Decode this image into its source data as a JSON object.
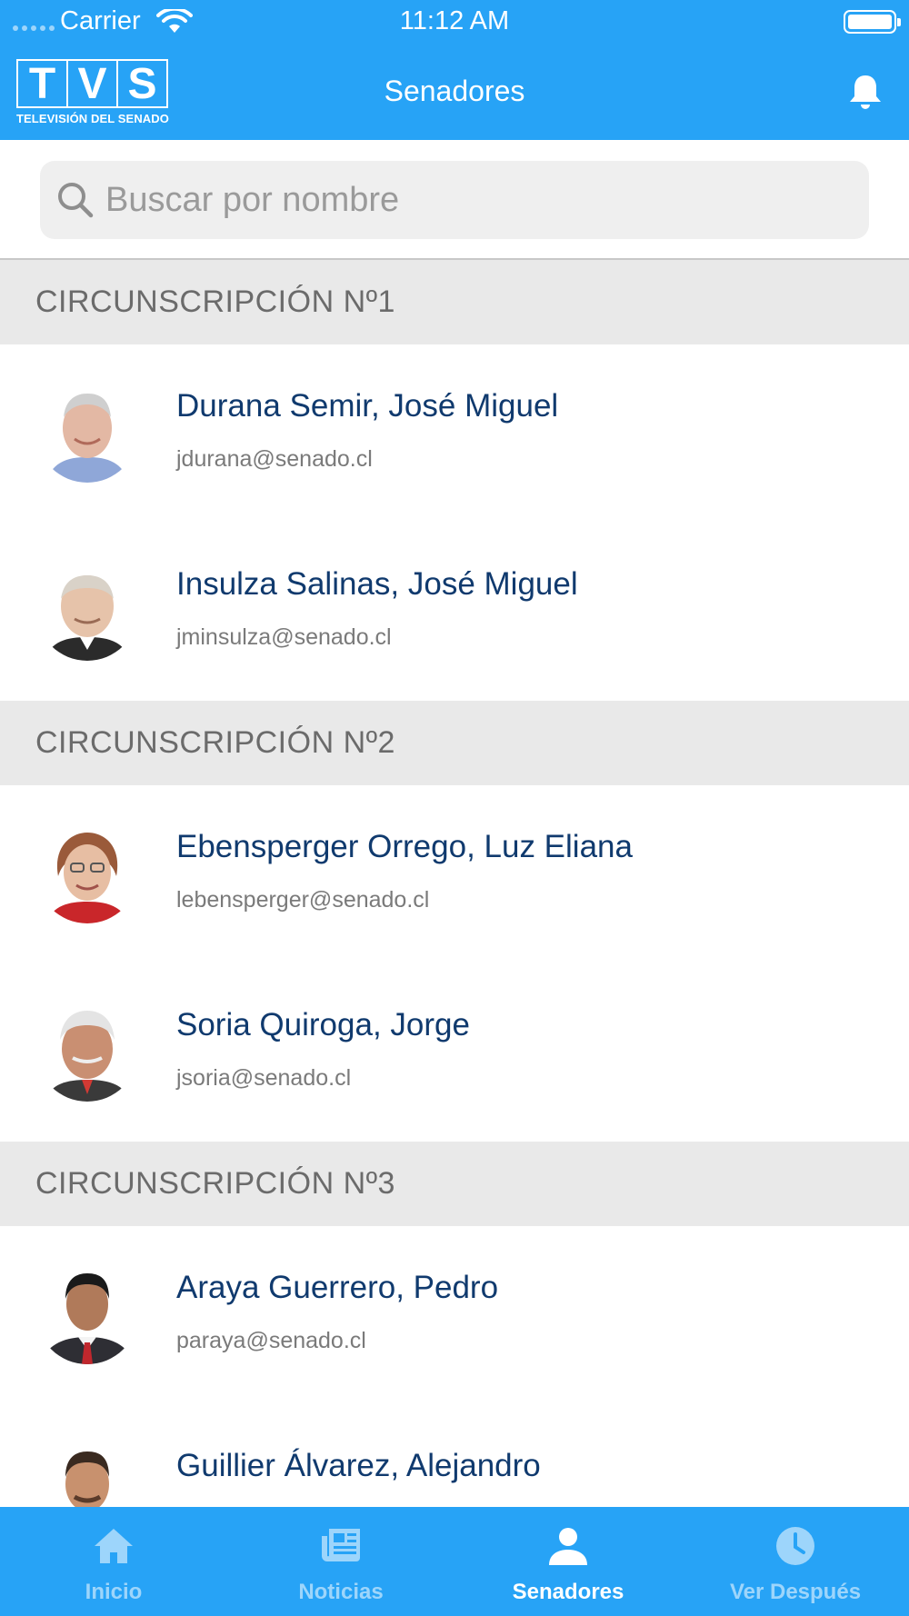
{
  "status_bar": {
    "carrier": "Carrier",
    "time": "11:12 AM"
  },
  "header": {
    "logo_letters": [
      "T",
      "V",
      "S"
    ],
    "logo_subtitle": "TELEVISIÓN DEL SENADO",
    "title": "Senadores"
  },
  "search": {
    "placeholder": "Buscar por nombre",
    "value": ""
  },
  "sections": [
    {
      "title": "CIRCUNSCRIPCIÓN Nº1",
      "senators": [
        {
          "name": "Durana Semir, José Miguel",
          "email": "jdurana@senado.cl"
        },
        {
          "name": "Insulza Salinas, José Miguel",
          "email": "jminsulza@senado.cl"
        }
      ]
    },
    {
      "title": "CIRCUNSCRIPCIÓN Nº2",
      "senators": [
        {
          "name": "Ebensperger Orrego, Luz Eliana",
          "email": "lebensperger@senado.cl"
        },
        {
          "name": "Soria Quiroga, Jorge",
          "email": "jsoria@senado.cl"
        }
      ]
    },
    {
      "title": "CIRCUNSCRIPCIÓN Nº3",
      "senators": [
        {
          "name": "Araya Guerrero, Pedro",
          "email": "paraya@senado.cl"
        },
        {
          "name": "Guillier Álvarez, Alejandro",
          "email": ""
        }
      ]
    }
  ],
  "tabbar": {
    "tabs": [
      {
        "label": "Inicio",
        "icon": "home-icon",
        "active": false
      },
      {
        "label": "Noticias",
        "icon": "newspaper-icon",
        "active": false
      },
      {
        "label": "Senadores",
        "icon": "person-icon",
        "active": true
      },
      {
        "label": "Ver Después",
        "icon": "clock-icon",
        "active": false
      }
    ]
  },
  "colors": {
    "brand_blue": "#27a3f6",
    "name_text": "#103a6e",
    "section_bg": "#e9e9e9"
  }
}
